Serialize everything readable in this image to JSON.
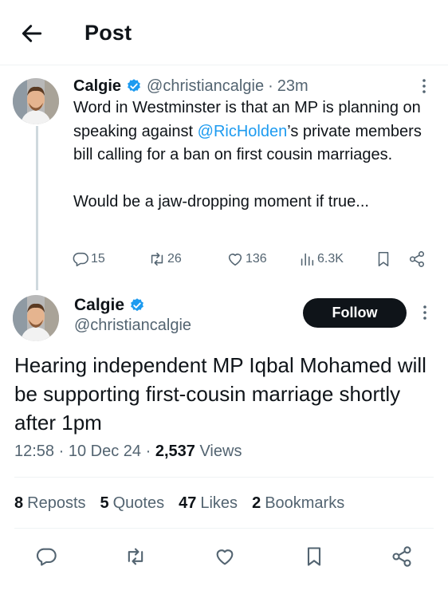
{
  "header": {
    "title": "Post",
    "back_icon": "arrow-left-icon"
  },
  "quoted_post": {
    "author_name": "Calgie",
    "handle": "@christiancalgie",
    "separator": "·",
    "time": "23m",
    "text_before_mention": "Word in Westminster is that an MP is planning on speaking against ",
    "mention": "@RicHolden",
    "text_after_mention": "’s private members bill calling for a ban on first cousin marriages.",
    "text_second_paragraph": "Would be a jaw-dropping moment if true...",
    "replies": "15",
    "reposts": "26",
    "likes": "136",
    "views": "6.3K"
  },
  "main_post": {
    "author_name": "Calgie",
    "handle": "@christiancalgie",
    "follow_label": "Follow",
    "text": "Hearing independent MP Iqbal Mohamed will be supporting first-cousin marriage shortly after 1pm",
    "time": "12:58",
    "date": "10 Dec 24",
    "views_count": "2,537",
    "views_label": "Views",
    "dot": "·"
  },
  "stats": {
    "reposts_count": "8",
    "reposts_label": "Reposts",
    "quotes_count": "5",
    "quotes_label": "Quotes",
    "likes_count": "47",
    "likes_label": "Likes",
    "bookmarks_count": "2",
    "bookmarks_label": "Bookmarks"
  },
  "colors": {
    "accent": "#1d9bf0",
    "text_primary": "#0f1419",
    "text_secondary": "#536471",
    "follow_button_bg": "#0f1419"
  },
  "icons": {
    "verified": "verified-badge-icon",
    "more": "more-vertical-icon",
    "reply": "reply-icon",
    "repost": "repost-icon",
    "like": "heart-icon",
    "views": "views-chart-icon",
    "bookmark": "bookmark-icon",
    "share": "share-icon"
  }
}
